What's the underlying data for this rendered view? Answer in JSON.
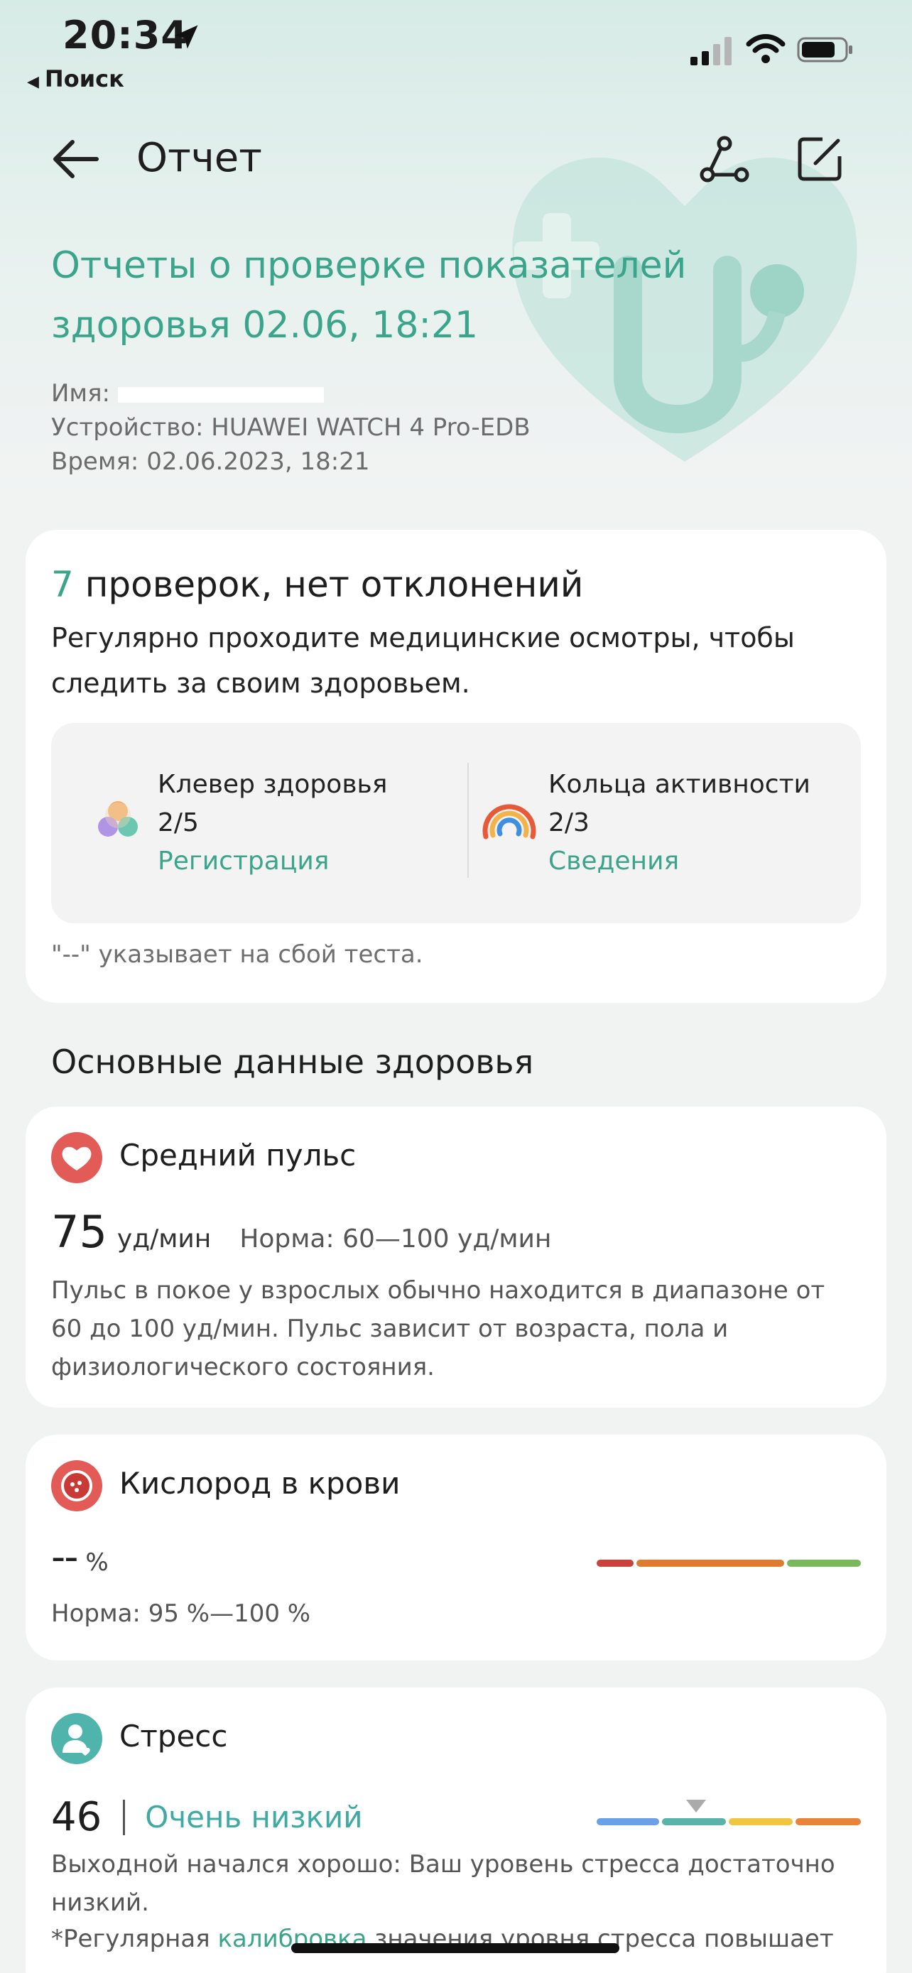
{
  "status_bar": {
    "time": "20:34",
    "back_app": "Поиск"
  },
  "nav": {
    "title": "Отчет"
  },
  "report": {
    "title": "Отчеты о проверке показателей здоровья 02.06, 18:21",
    "name_label": "Имя:",
    "device": "Устройство: HUAWEI WATCH 4 Pro-EDB",
    "time": "Время: 02.06.2023, 18:21"
  },
  "summary": {
    "count": "7",
    "headline": "проверок, нет отклонений",
    "description": "Регулярно проходите медицинские осмотры, чтобы следить за своим здоровьем.",
    "clover": {
      "label": "Клевер здоровья",
      "value": "2/5",
      "link": "Регистрация"
    },
    "rings": {
      "label": "Кольца активности",
      "value": "2/3",
      "link": "Сведения"
    },
    "note": "\"--\" указывает на сбой теста."
  },
  "section": {
    "title": "Основные данные здоровья"
  },
  "pulse": {
    "title": "Средний пульс",
    "value": "75",
    "unit": "уд/мин",
    "norm": "Норма: 60—100 уд/мин",
    "description": "Пульс в покое у взрослых обычно находится в диапазоне от 60 до 100 уд/мин. Пульс зависит от возраста, пола и физиологического состояния."
  },
  "oxygen": {
    "title": "Кислород в крови",
    "value": "--",
    "unit": "%",
    "norm": "Норма: 95 %—100 %"
  },
  "stress": {
    "title": "Стресс",
    "value": "46",
    "level": "Очень низкий",
    "description": "Выходной начался хорошо: Ваш уровень стресса достаточно низкий.",
    "calib_prefix": "*Регулярная ",
    "calib_link": "калибровка",
    "calib_suffix": " значения уровня стресса повышает"
  },
  "colors": {
    "accent": "#3aa58a",
    "scale_red": "#c9423c",
    "scale_orange": "#e07a30",
    "scale_green": "#7ab85c",
    "stress_blue": "#6aa0e6",
    "stress_teal": "#5ab3aa",
    "stress_yellow": "#f0c542",
    "stress_orange": "#e8843a"
  },
  "icons": [
    "location-arrow-icon",
    "signal-icon",
    "wifi-icon",
    "battery-icon",
    "back-arrow-icon",
    "share-icon",
    "edit-icon",
    "clover-icon",
    "activity-rings-icon",
    "heart-icon",
    "blood-oxygen-icon",
    "stress-person-icon"
  ]
}
